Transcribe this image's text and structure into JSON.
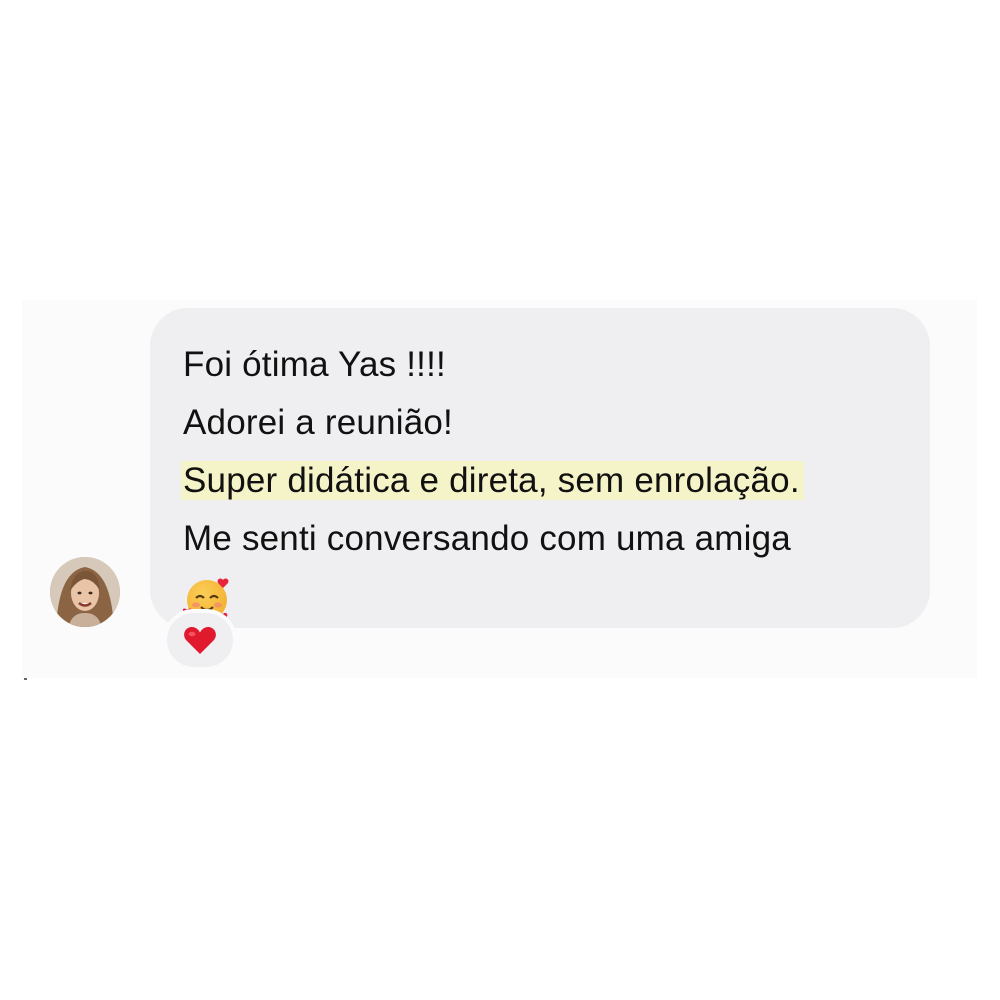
{
  "message": {
    "lines": [
      "Foi ótima Yas !!!!",
      "Adorei a reunião!",
      "Super didática e direta, sem enrolação.",
      "Me senti conversando com uma amiga"
    ],
    "highlighted_line_index": 2,
    "emoji": "smiling-face-with-hearts-icon"
  },
  "reaction": {
    "icon": "red-heart-icon"
  },
  "colors": {
    "bubble": "#efeff1",
    "highlight": "#f5f3c8",
    "heart": "#e0192d"
  }
}
